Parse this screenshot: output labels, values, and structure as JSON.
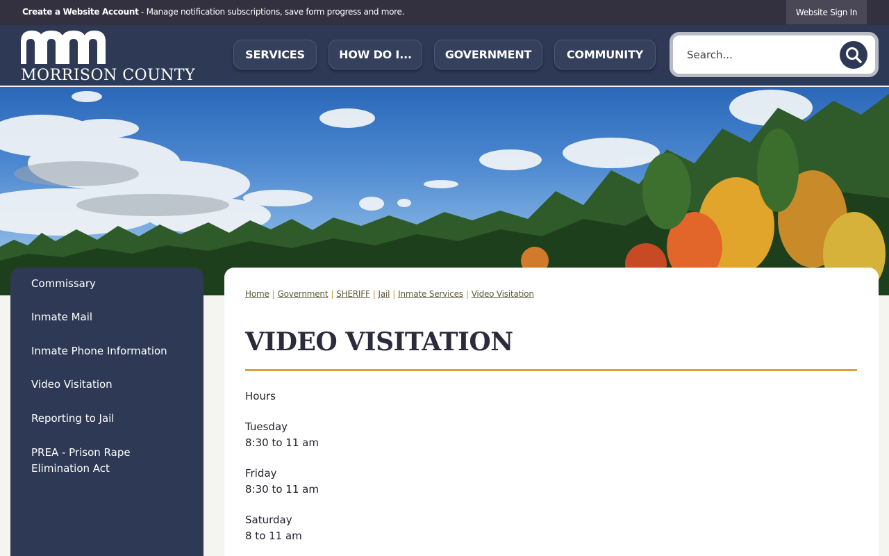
{
  "topbar": {
    "create_account": "Create a Website Account",
    "notice_rest": " - Manage notification subscriptions, save form progress and more.",
    "sign_in": "Website Sign In"
  },
  "header": {
    "logo_text": "MORRISON COUNTY",
    "nav": [
      "SERVICES",
      "HOW DO I...",
      "GOVERNMENT",
      "COMMUNITY"
    ],
    "search_placeholder": "Search..."
  },
  "sidebar": {
    "items": [
      "Commissary",
      "Inmate Mail",
      "Inmate Phone Information",
      "Video Visitation",
      "Reporting to Jail",
      "PREA - Prison Rape Elimination Act"
    ]
  },
  "content": {
    "breadcrumb": [
      "Home",
      "Government",
      "SHERIFF",
      "Jail",
      "Inmate Services",
      "Video Visitation"
    ],
    "title": "VIDEO VISITATION",
    "hours_label": "Hours",
    "schedule": [
      {
        "day": "Tuesday",
        "time": "8:30 to 11 am"
      },
      {
        "day": "Friday",
        "time": "8:30 to 11 am"
      },
      {
        "day": "Saturday",
        "time": "8 to 11 am"
      }
    ]
  },
  "colors": {
    "header_bg": "#2e3a55",
    "topbar_bg": "#33313f",
    "accent_rule": "#e29b3d",
    "breadcrumb_link": "#5c5a3a"
  }
}
